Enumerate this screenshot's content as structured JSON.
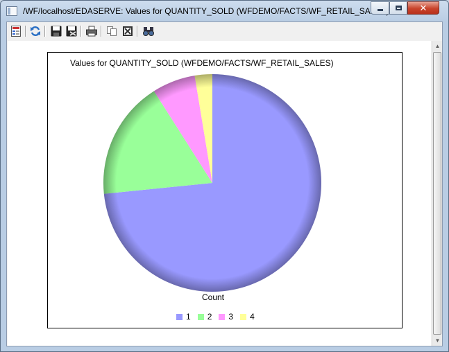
{
  "window": {
    "title": "/WF/localhost/EDASERVE: Values for QUANTITY_SOLD (WFDEMO/FACTS/WF_RETAIL_SALES)"
  },
  "toolbar": {
    "icons": [
      "report-icon",
      "refresh-icon",
      "save-icon",
      "save-as-icon",
      "print-icon",
      "copy-icon",
      "export-icon",
      "find-icon"
    ]
  },
  "colors": {
    "series1": "#9999ff",
    "series2": "#99ff99",
    "series3": "#ff99ff",
    "series4": "#ffff99"
  },
  "chart_data": {
    "type": "pie",
    "title": "Values for QUANTITY_SOLD (WFDEMO/FACTS/WF_RETAIL_SALES)",
    "xlabel": "Count",
    "categories": [
      "1",
      "2",
      "3",
      "4"
    ],
    "values": [
      73.4,
      17.6,
      6.4,
      2.6
    ],
    "legend_position": "bottom",
    "series_colors": [
      "#9999ff",
      "#99ff99",
      "#ff99ff",
      "#ffff99"
    ]
  }
}
